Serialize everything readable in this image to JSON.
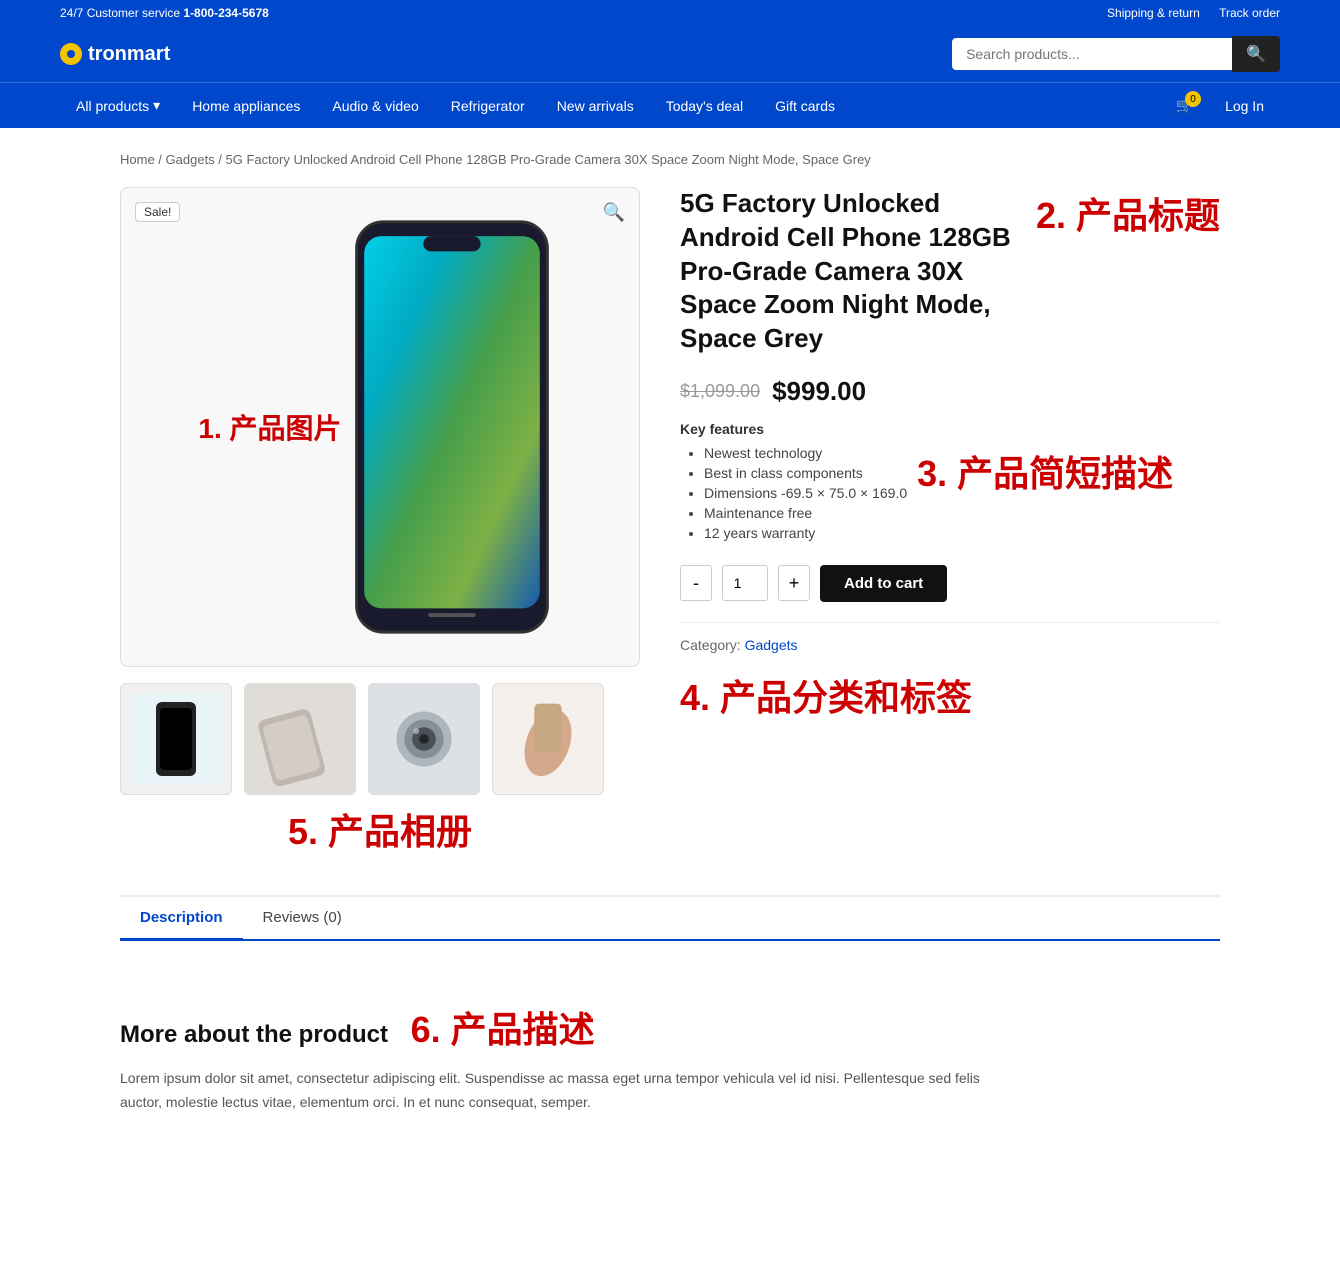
{
  "topbar": {
    "customer_service": "24/7 Customer service",
    "phone": "1-800-234-5678",
    "shipping_link": "Shipping & return",
    "track_link": "Track order"
  },
  "header": {
    "logo_text": "tronmart",
    "search_placeholder": "Search products...",
    "search_button_icon": "🔍"
  },
  "nav": {
    "items": [
      {
        "label": "All products",
        "has_arrow": true
      },
      {
        "label": "Home appliances",
        "has_arrow": false
      },
      {
        "label": "Audio & video",
        "has_arrow": false
      },
      {
        "label": "Refrigerator",
        "has_arrow": false
      },
      {
        "label": "New arrivals",
        "has_arrow": false
      },
      {
        "label": "Today's deal",
        "has_arrow": false
      },
      {
        "label": "Gift cards",
        "has_arrow": false
      }
    ],
    "cart_count": "0",
    "login_label": "Log In"
  },
  "breadcrumb": {
    "items": [
      "Home",
      "Gadgets",
      "5G Factory Unlocked Android Cell Phone 128GB Pro-Grade Camera 30X Space Zoom Night Mode, Space Grey"
    ]
  },
  "product": {
    "sale_badge": "Sale!",
    "title": "5G Factory Unlocked Android Cell Phone 128GB Pro-Grade Camera 30X Space Zoom Night Mode, Space Grey",
    "old_price": "$1,099.00",
    "new_price": "$999.00",
    "key_features_label": "Key features",
    "features": [
      "Newest technology",
      "Best in class components",
      "Dimensions -69.5 × 75.0 × 169.0",
      "Maintenance free",
      "12 years warranty"
    ],
    "quantity": "1",
    "minus_label": "-",
    "plus_label": "+",
    "add_to_cart_label": "Add to cart",
    "category_label": "Category:",
    "category_value": "Gadgets"
  },
  "annotations": {
    "a1": "1. 产品图片",
    "a2": "2. 产品标题",
    "a3": "3. 产品简短描述",
    "a4": "4. 产品分类和标签",
    "a5": "5. 产品相册",
    "a6": "6. 产品描述"
  },
  "tabs": [
    {
      "label": "Description",
      "active": true
    },
    {
      "label": "Reviews (0)",
      "active": false
    }
  ],
  "description": {
    "title": "More about the product",
    "text": "Lorem ipsum dolor sit amet, consectetur adipiscing elit. Suspendisse ac massa eget urna tempor vehicula vel id nisi. Pellentesque sed felis auctor, molestie lectus vitae, elementum orci. In et nunc consequat, semper."
  }
}
